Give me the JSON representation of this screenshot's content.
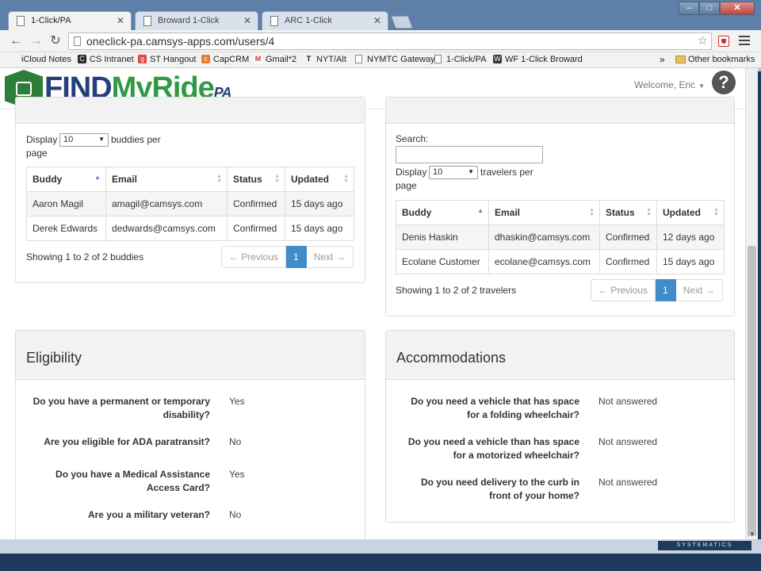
{
  "browser": {
    "tabs": [
      {
        "label": "1-Click/PA",
        "active": true
      },
      {
        "label": "Broward 1-Click",
        "active": false
      },
      {
        "label": "ARC 1-Click",
        "active": false
      }
    ],
    "url": "oneclick-pa.camsys-apps.com/users/4",
    "bookmarks": [
      "iCloud Notes",
      "CS Intranet",
      "ST Hangout",
      "CapCRM",
      "Gmail*2",
      "NYT/Alt",
      "NYMTC Gateway",
      "1-Click/PA",
      "WF 1-Click Broward"
    ],
    "bookmarks_more": "»",
    "other_bookmarks": "Other bookmarks"
  },
  "header": {
    "logo_find": "FIND",
    "logo_myride": "MyRide",
    "logo_pa": "PA",
    "welcome": "Welcome, Eric",
    "help": "?"
  },
  "buddies": {
    "display_label": "Display",
    "per_page_value": "10",
    "per_page_suffix": "buddies per",
    "per_page_suffix2": "page",
    "columns": [
      "Buddy",
      "Email",
      "Status",
      "Updated"
    ],
    "rows": [
      [
        "Aaron Magil",
        "amagil@camsys.com",
        "Confirmed",
        "15 days ago"
      ],
      [
        "Derek Edwards",
        "dedwards@camsys.com",
        "Confirmed",
        "15 days ago"
      ]
    ],
    "info": "Showing 1 to 2 of 2 buddies",
    "prev": "← Previous",
    "page": "1",
    "next": "Next →"
  },
  "travelers": {
    "search_label": "Search:",
    "display_label": "Display",
    "per_page_value": "10",
    "per_page_suffix": "travelers per",
    "per_page_suffix2": "page",
    "columns": [
      "Buddy",
      "Email",
      "Status",
      "Updated"
    ],
    "rows": [
      [
        "Denis Haskin",
        "dhaskin@camsys.com",
        "Confirmed",
        "12 days ago"
      ],
      [
        "Ecolane Customer",
        "ecolane@camsys.com",
        "Confirmed",
        "15 days ago"
      ]
    ],
    "info": "Showing 1 to 2 of 2 travelers",
    "prev": "← Previous",
    "page": "1",
    "next": "Next →"
  },
  "eligibility": {
    "title": "Eligibility",
    "items": [
      {
        "q1": "Do you have a permanent or temporary",
        "q2": "disability?",
        "a": "Yes"
      },
      {
        "q1": "Are you eligible for ADA paratransit?",
        "q2": "",
        "a": "No"
      },
      {
        "q1": "Do you have a Medical Assistance",
        "q2": "Access Card?",
        "a": "Yes"
      },
      {
        "q1": "Are you a military veteran?",
        "q2": "",
        "a": "No"
      }
    ]
  },
  "accommodations": {
    "title": "Accommodations",
    "items": [
      {
        "q1": "Do you need a vehicle that has space",
        "q2": "for a folding wheelchair?",
        "a": "Not answered"
      },
      {
        "q1": "Do you need a vehicle than has space",
        "q2": "for a motorized wheelchair?",
        "a": "Not answered"
      },
      {
        "q1": "Do you need delivery to the curb in",
        "q2": "front of your home?",
        "a": "Not answered"
      }
    ]
  },
  "footer": {
    "brand": "SYSTEMATICS"
  }
}
